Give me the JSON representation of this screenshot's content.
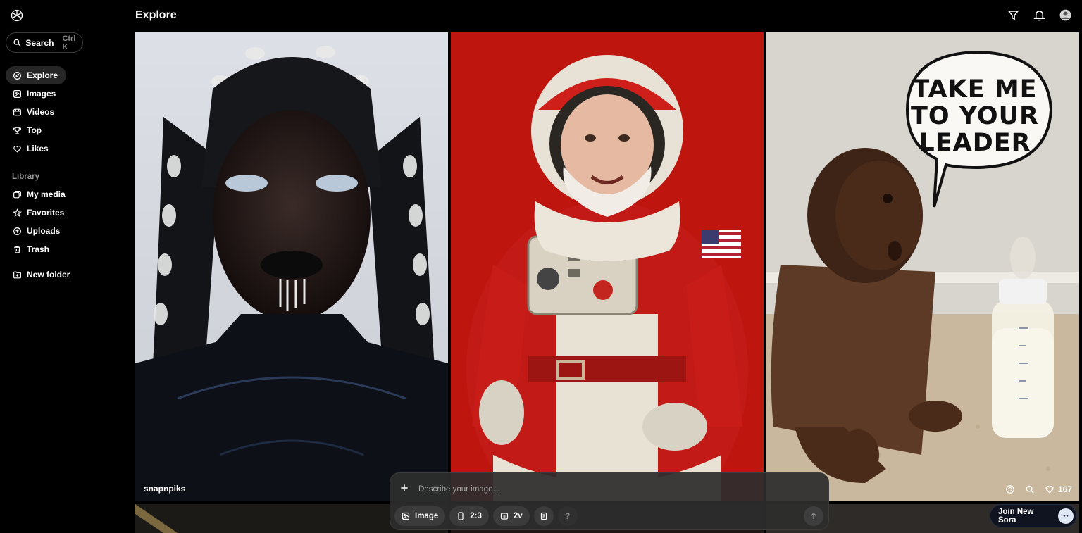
{
  "app": {
    "logo_icon": "openai-knot-icon"
  },
  "search": {
    "label": "Search",
    "shortcut": "Ctrl K"
  },
  "nav": {
    "main": [
      {
        "label": "Explore",
        "icon": "compass-icon",
        "active": true
      },
      {
        "label": "Images",
        "icon": "image-icon"
      },
      {
        "label": "Videos",
        "icon": "video-icon"
      },
      {
        "label": "Top",
        "icon": "trophy-icon"
      },
      {
        "label": "Likes",
        "icon": "heart-icon"
      }
    ],
    "library_label": "Library",
    "library": [
      {
        "label": "My media",
        "icon": "media-icon"
      },
      {
        "label": "Favorites",
        "icon": "star-icon"
      },
      {
        "label": "Uploads",
        "icon": "upload-icon"
      },
      {
        "label": "Trash",
        "icon": "trash-icon"
      }
    ],
    "new_folder": "New folder"
  },
  "header": {
    "title": "Explore"
  },
  "cards": [
    {
      "author": "snapnpiks"
    },
    {
      "author": ""
    },
    {
      "author": "",
      "speech_lines": [
        "TAKE ME",
        "TO YOUR",
        "LEADER"
      ],
      "likes": "167"
    }
  ],
  "prompt": {
    "placeholder": "Describe your image...",
    "type": "Image",
    "aspect": "2:3",
    "variations": "2v",
    "help": "?"
  },
  "join": {
    "label": "Join New Sora"
  },
  "colors": {
    "background": "#000000",
    "active_nav": "#262626",
    "prompt_bg": "#2d2d2d"
  }
}
